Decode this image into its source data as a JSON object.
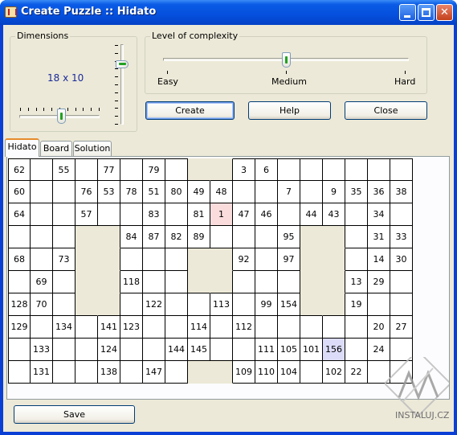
{
  "window": {
    "title": "Create Puzzle :: Hidato"
  },
  "dimensions": {
    "label": "Dimensions",
    "value": "18 x 10"
  },
  "complexity": {
    "label": "Level of complexity",
    "easy": "Easy",
    "medium": "Medium",
    "hard": "Hard",
    "level": 0.5
  },
  "buttons": {
    "create": "Create",
    "help": "Help",
    "close": "Close",
    "save": "Save"
  },
  "tabs": [
    "Hidato",
    "Board",
    "Solution"
  ],
  "grid": {
    "cols": 18,
    "rows": 10,
    "cells": [
      [
        "62",
        "",
        "55",
        "",
        "77",
        "",
        "79",
        "",
        "#",
        "#",
        "3",
        "6",
        "",
        "",
        "",
        "",
        "",
        ""
      ],
      [
        "60",
        "",
        "",
        "76",
        "53",
        "78",
        "51",
        "80",
        "49",
        "48",
        "",
        "",
        "7",
        "",
        "9",
        "35",
        "36",
        "38"
      ],
      [
        "64",
        "",
        "",
        "57",
        "",
        "",
        "83",
        "",
        "81",
        "1",
        "47",
        "46",
        "",
        "44",
        "43",
        "",
        "34",
        ""
      ],
      [
        "",
        "",
        "",
        "#",
        "#",
        "84",
        "87",
        "82",
        "89",
        "",
        "",
        "",
        "95",
        "#",
        "#",
        "",
        "31",
        "33"
      ],
      [
        "68",
        "",
        "73",
        "#",
        "#",
        "",
        "",
        "",
        "#",
        "#",
        "92",
        "",
        "97",
        "#",
        "#",
        "",
        "14",
        "30"
      ],
      [
        "",
        "69",
        "",
        "#",
        "#",
        "118",
        "",
        "",
        "#",
        "#",
        "",
        "",
        "",
        "#",
        "#",
        "13",
        "29",
        ""
      ],
      [
        "128",
        "70",
        "",
        "#",
        "#",
        "",
        "122",
        "",
        "",
        "113",
        "",
        "99",
        "154",
        "#",
        "#",
        "19",
        "",
        ""
      ],
      [
        "129",
        "",
        "134",
        "",
        "141",
        "123",
        "",
        "",
        "114",
        "",
        "112",
        "",
        "",
        "",
        "",
        "",
        "20",
        "27"
      ],
      [
        "",
        "133",
        "",
        "",
        "124",
        "",
        "",
        "144",
        "145",
        "",
        "",
        "111",
        "105",
        "101",
        "156",
        "",
        "24",
        ""
      ],
      [
        "",
        "131",
        "",
        "",
        "138",
        "",
        "147",
        "",
        "#",
        "#",
        "109",
        "110",
        "104",
        "",
        "102",
        "22",
        "",
        ""
      ]
    ],
    "start_value": "1",
    "end_value": "156"
  },
  "watermark": {
    "text": "INSTALUJ.CZ"
  }
}
